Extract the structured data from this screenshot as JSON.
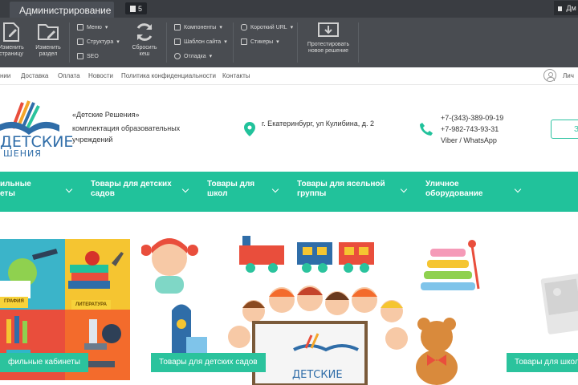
{
  "admin": {
    "tab_label": "Администрирование",
    "notifications_count": "5",
    "user_short": "Дм",
    "tools": {
      "edit_page": "Изменить страницу",
      "edit_section": "Изменить раздел",
      "menu": "Меню",
      "structure": "Структура",
      "seo": "SEO",
      "reset_cache": "Сбросить кеш",
      "components": "Компоненты",
      "site_template": "Шаблон сайта",
      "debug": "Отладка",
      "short_url": "Короткий URL",
      "stickers": "Стикеры",
      "test_solution": "Протестировать новое решение"
    }
  },
  "topnav": {
    "items": [
      "нии",
      "Доставка",
      "Оплата",
      "Новости",
      "Политика конфиденциальности",
      "Контакты"
    ],
    "personal": "Лич"
  },
  "header": {
    "logo_word": "ДЕТСКИЕ",
    "logo_sub": "ШЕНИЯ",
    "tagline_title": "«Детские Решения»",
    "tagline_text": "комплектация образовательных учреждений",
    "address": "г. Екатеринбург, ул Кулибина, д. 2",
    "phone1": "+7-(343)-389-09-19",
    "phone2": "+7-982-743-93-31",
    "messengers": "Viber / WhatsApp",
    "button_label": "З"
  },
  "catmenu": {
    "items": [
      {
        "line1": "ильные",
        "line2": "еты"
      },
      {
        "line1": "Товары для детских",
        "line2": "садов"
      },
      {
        "line1": "Товары для",
        "line2": "школ"
      },
      {
        "line1": "Товары для ясельной",
        "line2": "группы"
      },
      {
        "line1": "Уличное",
        "line2": "оборудование"
      }
    ]
  },
  "banners": {
    "tile_labels": [
      "ГРАФИЯ",
      "ЛИТЕРАТУРА"
    ],
    "left_button": "фильные кабинеты",
    "center_button": "Товары для детских садов",
    "right_button": "Товары для школ",
    "inner_logo": "ДЕТСКИЕ"
  },
  "colors": {
    "accent_green": "#21c29b",
    "brand_blue": "#2f6da8",
    "admin_dark": "#3a3d42"
  }
}
